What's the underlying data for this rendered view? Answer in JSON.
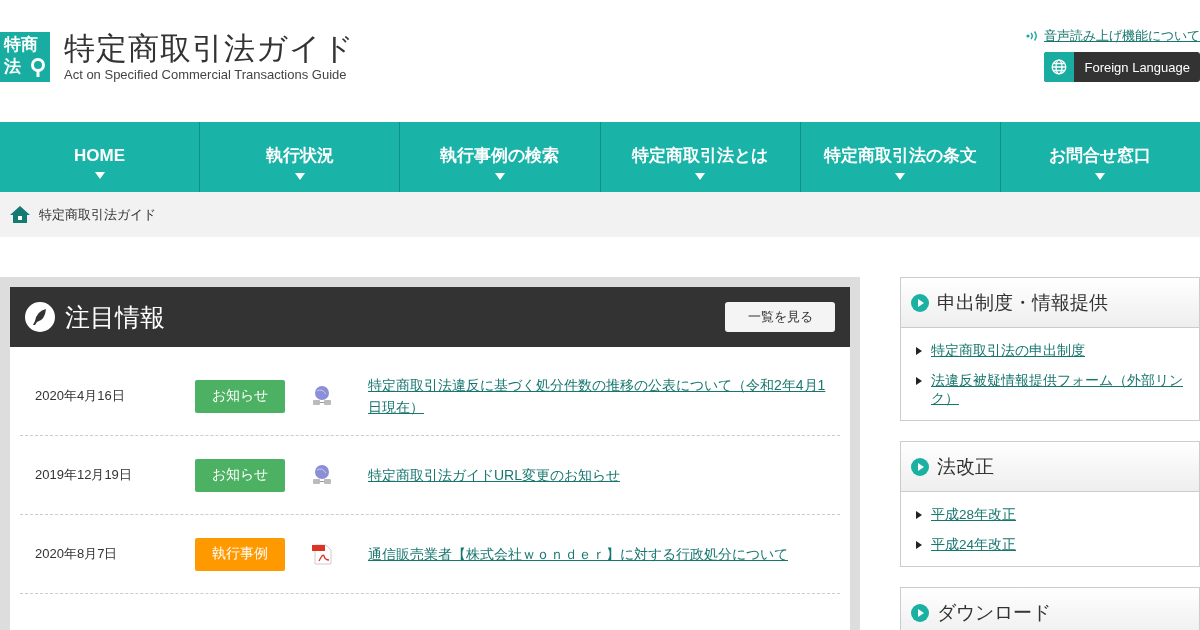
{
  "header": {
    "logo_badge": [
      "特商",
      "法"
    ],
    "site_title": "特定商取引法ガイド",
    "site_subtitle": "Act on Specified Commercial Transactions Guide",
    "speech_link": "音声読み上げ機能について",
    "language_button": "Foreign Language"
  },
  "nav": [
    {
      "label": "HOME"
    },
    {
      "label": "執行状況"
    },
    {
      "label": "執行事例の検索"
    },
    {
      "label": "特定商取引法とは"
    },
    {
      "label": "特定商取引法の条文"
    },
    {
      "label": "お問合せ窓口"
    }
  ],
  "breadcrumb": [
    "特定商取引法ガイド"
  ],
  "news": {
    "title": "注目情報",
    "list_button": "一覧を見る",
    "items": [
      {
        "date": "2020年4月16日",
        "tag": "お知らせ",
        "color": "#4cb162",
        "kind": "web",
        "title": "特定商取引法違反に基づく処分件数の推移の公表について（令和2年4月1日現在）"
      },
      {
        "date": "2019年12月19日",
        "tag": "お知らせ",
        "color": "#4cb162",
        "kind": "web",
        "title": "特定商取引法ガイドURL変更のお知らせ"
      },
      {
        "date": "2020年8月7日",
        "tag": "執行事例",
        "color": "#ff9900",
        "kind": "pdf",
        "title": "通信販売業者【株式会社ｗｏｎｄｅｒ】に対する行政処分について"
      }
    ]
  },
  "sidebar": [
    {
      "title": "申出制度・情報提供",
      "links": [
        "特定商取引法の申出制度",
        "法違反被疑情報提供フォーム（外部リンク）"
      ]
    },
    {
      "title": "法改正",
      "links": [
        "平成28年改正",
        "平成24年改正"
      ]
    },
    {
      "title": "ダウンロード"
    }
  ]
}
